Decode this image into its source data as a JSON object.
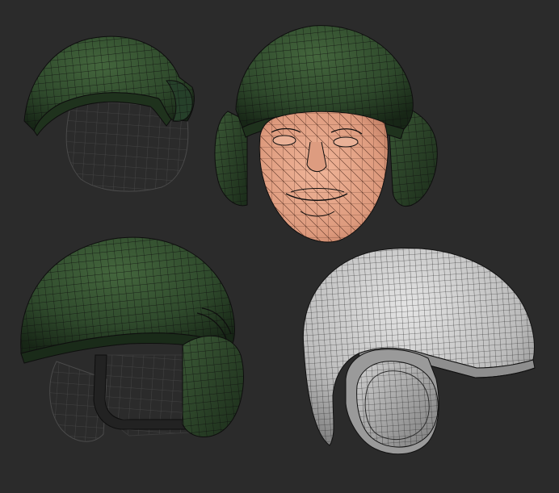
{
  "scene": {
    "background_color": "#2b2b2b",
    "wire_color": "#0e0e0e",
    "helmet_green": "#2f4a2c",
    "helmet_green_light": "#3d5c38",
    "helmet_green_dark": "#1c2e1b",
    "helmet_grey": "#b9b9b9",
    "helmet_grey_light": "#dadada",
    "helmet_grey_dark": "#6f6f6f",
    "skin_color": "#e6a68a",
    "skin_shadow": "#b9775d",
    "wire_shell_color": "#3a3a3a"
  },
  "renders": [
    {
      "icon": "helmet-shell-cap-icon"
    },
    {
      "icon": "helmet-on-head-icon"
    },
    {
      "icon": "green-helmet-with-earcups-icon"
    },
    {
      "icon": "grey-helmet-with-earcups-icon"
    }
  ]
}
